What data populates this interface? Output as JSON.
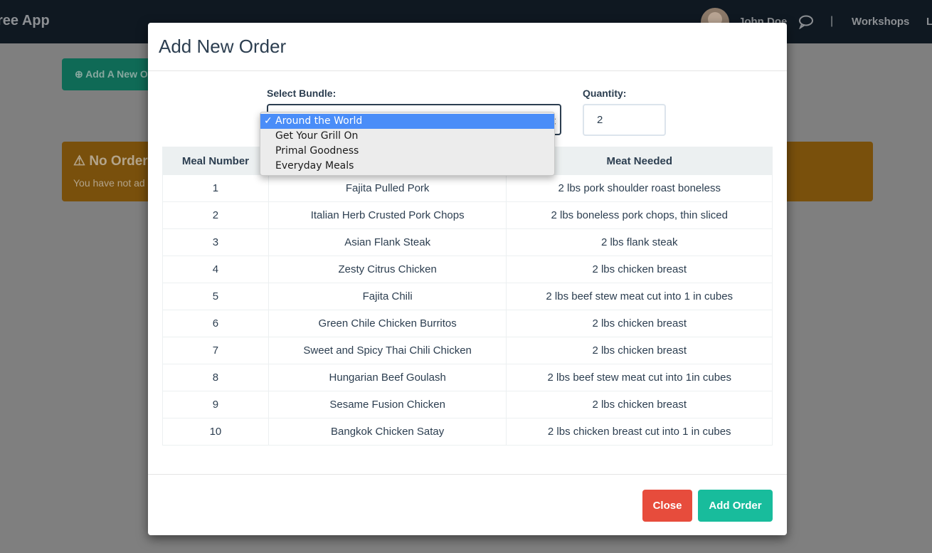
{
  "navbar": {
    "brand": "ree App",
    "user_name": "John Doe",
    "separator": "|",
    "links": [
      "Workshops",
      "L"
    ]
  },
  "background": {
    "add_button_label": "Add A New O",
    "alert_title": "No Order",
    "alert_text": "You have not ad"
  },
  "modal": {
    "title": "Add New Order",
    "bundle_label": "Select Bundle:",
    "quantity_label": "Quantity:",
    "quantity_value": "2",
    "bundle_options": [
      "Around the World",
      "Get Your Grill On",
      "Primal Goodness",
      "Everyday Meals"
    ],
    "selected_option_index": 0,
    "check_glyph": "✓",
    "table": {
      "headers": [
        "Meal Number",
        "",
        "Meat Needed"
      ],
      "rows": [
        [
          "1",
          "Fajita Pulled Pork",
          "2 lbs pork shoulder roast boneless"
        ],
        [
          "2",
          "Italian Herb Crusted Pork Chops",
          "2 lbs boneless pork chops, thin sliced"
        ],
        [
          "3",
          "Asian Flank Steak",
          "2 lbs flank steak"
        ],
        [
          "4",
          "Zesty Citrus Chicken",
          "2 lbs chicken breast"
        ],
        [
          "5",
          "Fajita Chili",
          "2 lbs beef stew meat cut into 1 in cubes"
        ],
        [
          "6",
          "Green Chile Chicken Burritos",
          "2 lbs chicken breast"
        ],
        [
          "7",
          "Sweet and Spicy Thai Chili Chicken",
          "2 lbs chicken breast"
        ],
        [
          "8",
          "Hungarian Beef Goulash",
          "2 lbs beef stew meat cut into 1in cubes"
        ],
        [
          "9",
          "Sesame Fusion Chicken",
          "2 lbs chicken breast"
        ],
        [
          "10",
          "Bangkok Chicken Satay",
          "2 lbs chicken breast cut into 1 in cubes"
        ]
      ]
    },
    "close_label": "Close",
    "add_order_label": "Add Order"
  },
  "colors": {
    "primary_dark": "#2c3e50",
    "success": "#18bc9c",
    "danger": "#e74c3c",
    "dropdown_highlight": "#4a8df8"
  },
  "icons": [
    "user-avatar",
    "chat-icon",
    "plus-circle-icon",
    "warning-icon",
    "checkmark-icon",
    "select-caret-icon"
  ]
}
